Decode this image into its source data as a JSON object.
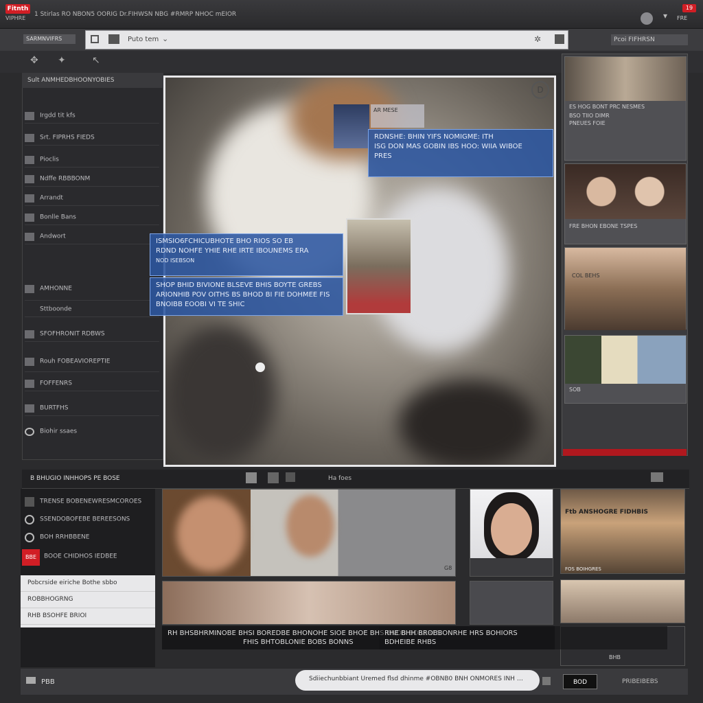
{
  "topbar": {
    "logo": "Fitnth",
    "logo_sub": "VIPHRE",
    "title": "1 Stirlas RO NBON5 OORIG Dr.FIHWSN NBG #RMRP NHOC mEIOR",
    "badge": "19",
    "sub2": "FRE"
  },
  "nav": {
    "site_label": "SARMNVIFRS",
    "url_text": "Puto tem",
    "account": "Pcoi FIFHRSN"
  },
  "left_panel": {
    "header": "Sult ANMHEDBHOONYOBIES",
    "items": [
      {
        "label": "Irgdd tit kfs"
      },
      {
        "label": "Srt. FIPRHS FIEDS"
      },
      {
        "label": "Pioclis"
      },
      {
        "label": "Ndffe RBBBONM"
      },
      {
        "label": "Arrandt"
      },
      {
        "label": "Bonlle Bans"
      },
      {
        "label": "Andwort"
      },
      {
        "label": "AMHONNE"
      },
      {
        "label": "Sttboonde"
      },
      {
        "label": "SFOFHRONIT RDBWS"
      },
      {
        "label": "Rouh FOBEAVIOREPTIE"
      },
      {
        "label": "FOFFENRS"
      },
      {
        "label": "BURTFHS"
      },
      {
        "label": "Biohir ssaes"
      }
    ]
  },
  "bubbles": {
    "top": [
      "RDNSHE: BHIN YIFS NOMIGME: ITH",
      "ISG DON MAS GOBIN IBS HOO: WIIA WIBOE",
      "PRES"
    ],
    "mid": [
      "ISMSIO6FCHICUBHOTE BHO RIOS SO EB",
      "RDND NOHFE YHIE RHE IRTE IBOUNEMS ERA"
    ],
    "mid_sub": "NOD ISEBSON",
    "low": [
      "SHOP BHID BIVIONE BLSEVE BHIS BOYTE GREBS",
      "ARIONHIB POV OITHS BS BHOD BI FIE DOHMEE FIS",
      "BNOIBB EOOBI VI TE SHIC"
    ],
    "thumb_a_label": "AR MESE"
  },
  "right_col": {
    "card1_lines": [
      "ES HOG BONT PRC NESMES",
      "BSO TIIO DIMR",
      "PNEUES FOIE"
    ],
    "card2_line": "FRE BHON EBONE TSPES",
    "card3_title": "COL BEHS",
    "card4_label": "SOB"
  },
  "bottom": {
    "bar_label": "B BHUGIO INHHOPS PE BOSE",
    "bar_mid": "Ha foes",
    "left_rows": [
      {
        "label": "TRENSE BOBENEWRESMCOROES"
      },
      {
        "label": "SSENDOBOFEBE BEREESONS"
      },
      {
        "label": "BOH RRHBBENE"
      },
      {
        "label": "BOOE CHIDHOS IEDBEE"
      }
    ],
    "red_label": "BBE",
    "menu_items": [
      "Pobcrside eiriche Bothe sbbo",
      "ROBBHOGRNG",
      "RHB BSOHFE BRIOI"
    ],
    "captions_left": [
      "RH BHSBHRMINOBE BHSI BOREDBE BHONOHE SIOE BHOE BHS BNOB BORERES",
      "FHIS BHTOBLONIE BOBS BONNS"
    ],
    "captions_right": [
      "RHE BHH BROBBONRHE HRS BOHIORS",
      "BDHEIBE RHBS"
    ],
    "card_tag": "G8",
    "card_right_title": "FOS BOIHGRES",
    "card_right_sub": "Ftb ANSHOGRE FIDHBIS",
    "card_right_foot": "BHB",
    "pill_text": "Sdiiechunbbiant Uremed flsd dhinme #OBNB0 BNH ONMORES INH BE BSI",
    "pill_btn": "BOD",
    "footer_left": "PBB",
    "footer_right": "PRIBEIBEBS"
  }
}
